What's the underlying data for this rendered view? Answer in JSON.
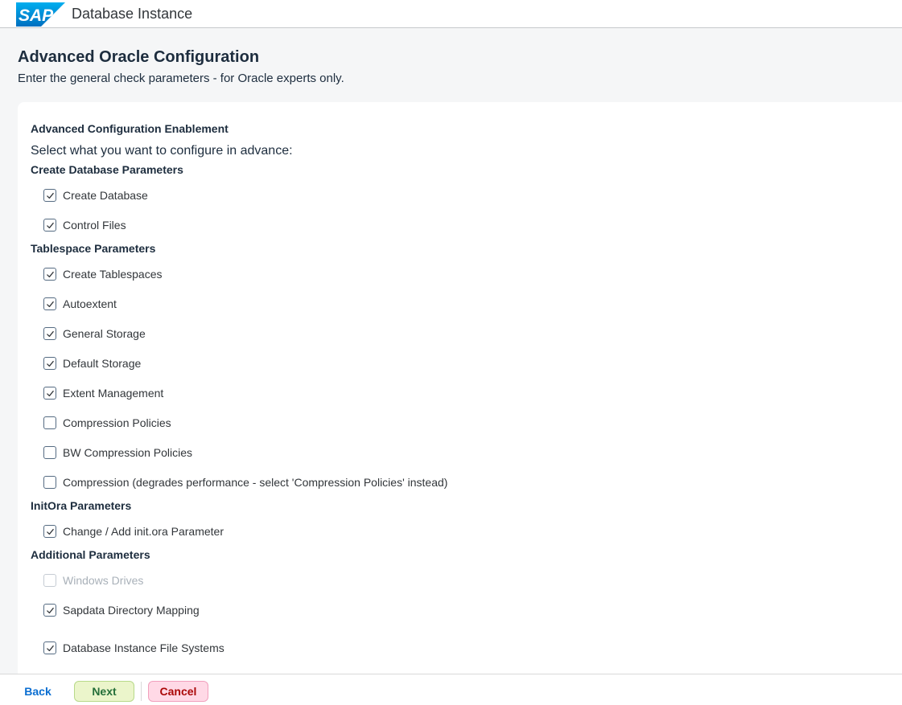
{
  "header": {
    "logo_text": "SAP",
    "title": "Database Instance"
  },
  "page": {
    "title": "Advanced Oracle Configuration",
    "subtitle": "Enter the general check parameters - for Oracle experts only."
  },
  "panel": {
    "heading": "Advanced Configuration Enablement",
    "intro": "Select what you want to configure in advance:",
    "sections": [
      {
        "title": "Create Database Parameters",
        "items": [
          {
            "label": "Create Database",
            "checked": true,
            "disabled": false
          },
          {
            "label": "Control Files",
            "checked": true,
            "disabled": false
          }
        ]
      },
      {
        "title": "Tablespace Parameters",
        "items": [
          {
            "label": "Create Tablespaces",
            "checked": true,
            "disabled": false
          },
          {
            "label": "Autoextent",
            "checked": true,
            "disabled": false
          },
          {
            "label": "General Storage",
            "checked": true,
            "disabled": false
          },
          {
            "label": "Default Storage",
            "checked": true,
            "disabled": false
          },
          {
            "label": "Extent Management",
            "checked": true,
            "disabled": false
          },
          {
            "label": "Compression Policies",
            "checked": false,
            "disabled": false
          },
          {
            "label": "BW Compression Policies",
            "checked": false,
            "disabled": false
          },
          {
            "label": "Compression (degrades performance - select 'Compression Policies' instead)",
            "checked": false,
            "disabled": false
          }
        ]
      },
      {
        "title": "InitOra Parameters",
        "items": [
          {
            "label": "Change / Add init.ora Parameter",
            "checked": true,
            "disabled": false
          }
        ]
      },
      {
        "title": "Additional Parameters",
        "items": [
          {
            "label": "Windows Drives",
            "checked": false,
            "disabled": true
          },
          {
            "label": "Sapdata Directory Mapping",
            "checked": true,
            "disabled": false
          },
          {
            "label": "Database Instance File Systems",
            "checked": true,
            "disabled": false
          }
        ]
      }
    ]
  },
  "footer": {
    "back_label": "Back",
    "next_label": "Next",
    "cancel_label": "Cancel"
  },
  "colors": {
    "accent": "#0a6ed1",
    "next_bg": "#ebf5cb",
    "cancel_bg": "#ffd9e6"
  }
}
